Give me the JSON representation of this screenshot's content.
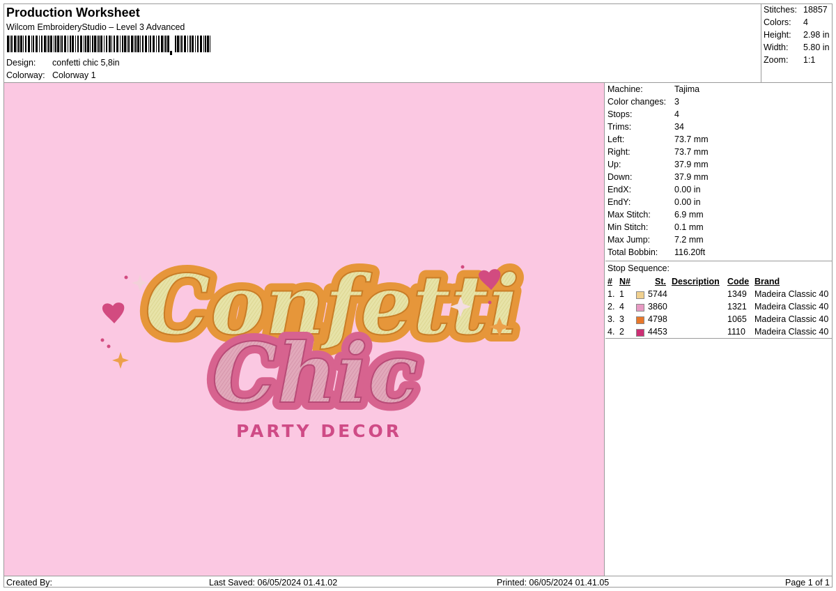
{
  "header": {
    "title": "Production Worksheet",
    "subtitle": "Wilcom EmbroideryStudio – Level 3 Advanced",
    "barcode_icon": "barcode-icon",
    "design_label": "Design:",
    "design_value": "confetti chic 5,8in",
    "colorway_label": "Colorway:",
    "colorway_value": "Colorway 1"
  },
  "summary": {
    "stitches_label": "Stitches:",
    "stitches_value": "18857",
    "colors_label": "Colors:",
    "colors_value": "4",
    "height_label": "Height:",
    "height_value": "2.98 in",
    "width_label": "Width:",
    "width_value": "5.80 in",
    "zoom_label": "Zoom:",
    "zoom_value": "1:1"
  },
  "design_preview": {
    "line1": "Confetti",
    "line2": "Chic",
    "line3": "PARTY DECOR",
    "background": "#fbc8e2",
    "icons": [
      "heart-icon",
      "sparkle-icon",
      "dot-icon"
    ]
  },
  "machine_info": [
    {
      "label": "Machine:",
      "value": "Tajima"
    },
    {
      "label": "Color changes:",
      "value": "3"
    },
    {
      "label": "Stops:",
      "value": "4"
    },
    {
      "label": "Trims:",
      "value": "34"
    },
    {
      "label": "Left:",
      "value": "73.7 mm"
    },
    {
      "label": "Right:",
      "value": "73.7 mm"
    },
    {
      "label": "Up:",
      "value": "37.9 mm"
    },
    {
      "label": "Down:",
      "value": "37.9 mm"
    },
    {
      "label": "EndX:",
      "value": "0.00 in"
    },
    {
      "label": "EndY:",
      "value": "0.00 in"
    },
    {
      "label": "Max Stitch:",
      "value": "6.9 mm"
    },
    {
      "label": "Min Stitch:",
      "value": "0.1 mm"
    },
    {
      "label": "Max Jump:",
      "value": "7.2 mm"
    },
    {
      "label": "Total Bobbin:",
      "value": "116.20ft"
    }
  ],
  "stop_sequence": {
    "title": "Stop Sequence:",
    "headers": {
      "num": "#",
      "n": "N#",
      "st": "St.",
      "description": "Description",
      "code": "Code",
      "brand": "Brand"
    },
    "rows": [
      {
        "num": "1.",
        "n": "1",
        "color": "#f0d08e",
        "st": "5744",
        "description": "",
        "code": "1349",
        "brand": "Madeira Classic 40"
      },
      {
        "num": "2.",
        "n": "4",
        "color": "#e79ac3",
        "st": "3860",
        "description": "",
        "code": "1321",
        "brand": "Madeira Classic 40"
      },
      {
        "num": "3.",
        "n": "3",
        "color": "#e8782a",
        "st": "4798",
        "description": "",
        "code": "1065",
        "brand": "Madeira Classic 40"
      },
      {
        "num": "4.",
        "n": "2",
        "color": "#cc2f74",
        "st": "4453",
        "description": "",
        "code": "1110",
        "brand": "Madeira Classic 40"
      }
    ]
  },
  "footer": {
    "created_by": "Created By:",
    "last_saved": "Last Saved: 06/05/2024 01.41.02",
    "printed": "Printed: 06/05/2024 01.41.05",
    "page": "Page 1 of 1"
  }
}
